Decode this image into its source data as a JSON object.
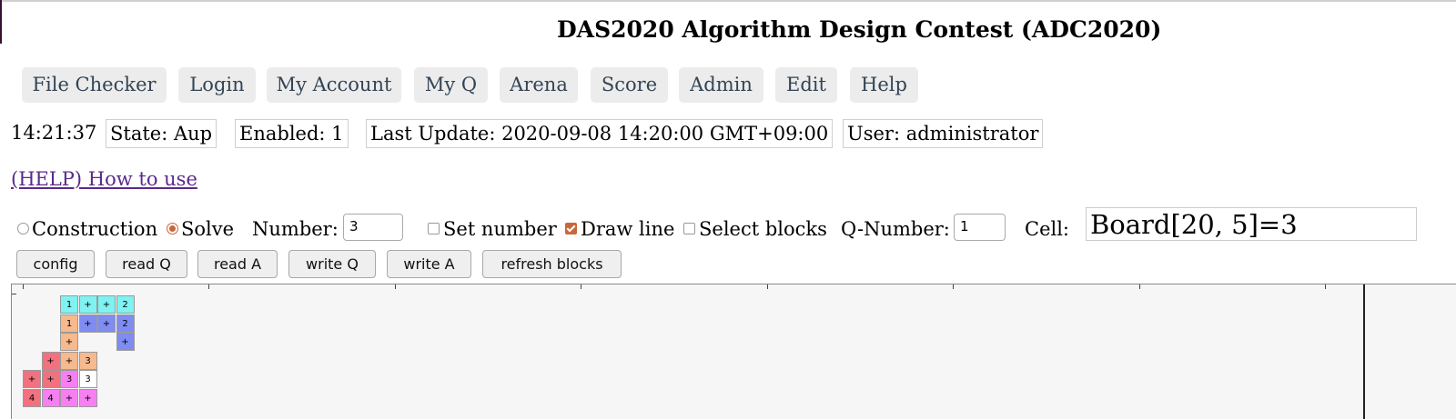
{
  "title": "DAS2020 Algorithm Design Contest (ADC2020)",
  "nav": {
    "items": [
      "File Checker",
      "Login",
      "My Account",
      "My Q",
      "Arena",
      "Score",
      "Admin",
      "Edit",
      "Help"
    ]
  },
  "status": {
    "clock": "14:21:37",
    "state": "State: Aup",
    "enabled": "Enabled: 1",
    "last_update": "Last Update: 2020-09-08 14:20:00 GMT+09:00",
    "user": "User: administrator"
  },
  "help_link": "(HELP) How to use",
  "controls": {
    "mode_construction": "Construction",
    "mode_solve": "Solve",
    "selected_mode": "Solve",
    "number_label": "Number:",
    "number_value": "3",
    "set_number": "Set number",
    "set_number_checked": false,
    "draw_line": "Draw line",
    "draw_line_checked": true,
    "select_blocks": "Select blocks",
    "select_blocks_checked": false,
    "qnumber_label": "Q-Number:",
    "qnumber_value": "1",
    "cell_label": "Cell:",
    "cell_value": "Board[20, 5]=3"
  },
  "buttons": {
    "config": "config",
    "read_q": "read Q",
    "read_a": "read A",
    "write_q": "write Q",
    "write_a": "write A",
    "refresh_blocks": "refresh blocks"
  },
  "board": {
    "colors": {
      "cyan": "#7ff2f2",
      "blue": "#7f8cf2",
      "orange": "#f7b98e",
      "red": "#f2717f",
      "magenta": "#f77ff2",
      "white": "#ffffff"
    },
    "cells": [
      {
        "row": 0,
        "col": 2,
        "text": "1",
        "color": "cyan"
      },
      {
        "row": 0,
        "col": 3,
        "text": "+",
        "color": "cyan"
      },
      {
        "row": 0,
        "col": 4,
        "text": "+",
        "color": "cyan"
      },
      {
        "row": 0,
        "col": 5,
        "text": "2",
        "color": "cyan"
      },
      {
        "row": 1,
        "col": 2,
        "text": "1",
        "color": "orange"
      },
      {
        "row": 1,
        "col": 3,
        "text": "+",
        "color": "blue"
      },
      {
        "row": 1,
        "col": 4,
        "text": "+",
        "color": "blue"
      },
      {
        "row": 1,
        "col": 5,
        "text": "2",
        "color": "blue"
      },
      {
        "row": 2,
        "col": 2,
        "text": "+",
        "color": "orange"
      },
      {
        "row": 2,
        "col": 5,
        "text": "+",
        "color": "blue"
      },
      {
        "row": 3,
        "col": 1,
        "text": "+",
        "color": "red"
      },
      {
        "row": 3,
        "col": 2,
        "text": "+",
        "color": "orange"
      },
      {
        "row": 3,
        "col": 3,
        "text": "3",
        "color": "orange"
      },
      {
        "row": 4,
        "col": 0,
        "text": "+",
        "color": "red"
      },
      {
        "row": 4,
        "col": 1,
        "text": "+",
        "color": "red"
      },
      {
        "row": 4,
        "col": 2,
        "text": "3",
        "color": "magenta"
      },
      {
        "row": 4,
        "col": 3,
        "text": "3",
        "color": "white"
      },
      {
        "row": 5,
        "col": 0,
        "text": "4",
        "color": "red"
      },
      {
        "row": 5,
        "col": 1,
        "text": "4",
        "color": "magenta"
      },
      {
        "row": 5,
        "col": 2,
        "text": "+",
        "color": "magenta"
      },
      {
        "row": 5,
        "col": 3,
        "text": "+",
        "color": "magenta"
      }
    ]
  }
}
